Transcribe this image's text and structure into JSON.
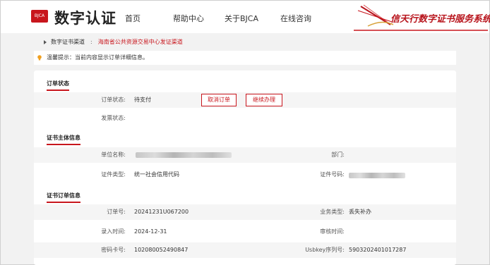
{
  "header": {
    "logo_badge": "BJCA",
    "logo_text": "数字认证",
    "nav": [
      "首页",
      "帮助中心",
      "关于BJCA",
      "在线咨询"
    ],
    "brand": "信天行数字证书服务系统"
  },
  "breadcrumb": {
    "root": "数字证书渠道",
    "sep": ":",
    "current": "海南省公共资源交易中心发证渠道"
  },
  "tip": "温馨提示：当前内容显示订单详细信息。",
  "order_status": {
    "title": "订单状态",
    "status_label": "订单状态:",
    "status_value": "待支付",
    "cancel_button": "取消订单",
    "continue_button": "继续办理",
    "invoice_label": "发票状态:"
  },
  "subject": {
    "title": "证书主体信息",
    "unit_label": "单位名称:",
    "dept_label": "部门:",
    "id_type_label": "证件类型:",
    "id_type_value": "统一社会信用代码",
    "id_number_label": "证件号码:"
  },
  "cert_order": {
    "title": "证书订单信息",
    "order_no_label": "订单号:",
    "order_no_value": "20241231U067200",
    "biz_type_label": "业务类型:",
    "biz_type_value": "丢失补办",
    "entry_time_label": "录入时间:",
    "entry_time_value": "2024-12-31",
    "review_time_label": "审核时间:",
    "pwd_card_label": "密码卡号:",
    "pwd_card_value": "102080052490847",
    "usbkey_label": "Usbkey序列号:",
    "usbkey_value": "5903202401017287"
  }
}
